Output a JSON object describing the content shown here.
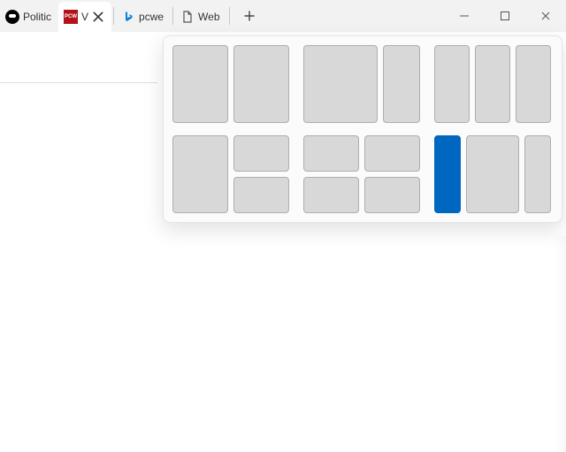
{
  "tabs": [
    {
      "label": "Politic",
      "favicon": "abc-logo"
    },
    {
      "label": "V",
      "favicon": "pcw-logo",
      "favicon_text": "PCW",
      "active": true
    },
    {
      "label": "pcwe",
      "favicon": "bing-logo"
    },
    {
      "label": "Web",
      "favicon": "page-icon"
    }
  ],
  "newtab": {
    "title": "New tab"
  },
  "window_controls": {
    "minimize": "Minimize",
    "maximize": "Maximize",
    "close": "Close"
  },
  "snap_layouts": {
    "title": "Snap layouts",
    "selected_layout_index": 5,
    "selected_zone_index": 0,
    "layouts": [
      {
        "name": "two-columns",
        "zones": 2
      },
      {
        "name": "two-thirds-one-third",
        "zones": 2
      },
      {
        "name": "three-columns",
        "zones": 3
      },
      {
        "name": "left-half-right-stack",
        "zones": 3
      },
      {
        "name": "quadrants",
        "zones": 4
      },
      {
        "name": "narrow-wide-narrow",
        "zones": 3
      }
    ]
  }
}
